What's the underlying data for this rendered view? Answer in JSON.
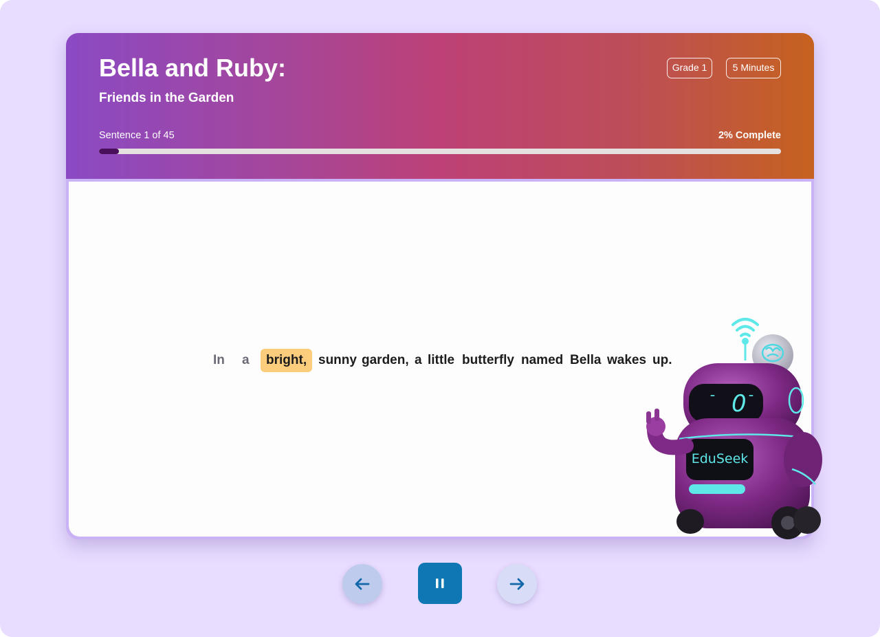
{
  "story": {
    "title": "Bella and Ruby:",
    "subtitle": "Friends in the Garden",
    "grade_badge": "Grade 1",
    "duration_badge": "5 Minutes"
  },
  "progress": {
    "label": "Sentence 1 of 45",
    "percent_label": "2% Complete",
    "fraction": 0.02
  },
  "sentence": {
    "words": [
      "In",
      "a",
      "bright,",
      "sunny",
      "garden,",
      "a",
      "little",
      "butterfly",
      "named",
      "Bella",
      "wakes",
      "up."
    ],
    "current_index": 2
  },
  "robot": {
    "screen_label": "EduSeek"
  },
  "controls": {
    "prev_icon": "arrow-left-icon",
    "pause_icon": "pause-icon",
    "next_icon": "arrow-right-icon"
  },
  "colors": {
    "page_bg": "#e8dcff",
    "highlight": "#fbcd7c",
    "progress_fill": "#4a0f5a",
    "pause_button": "#0f78b4"
  }
}
